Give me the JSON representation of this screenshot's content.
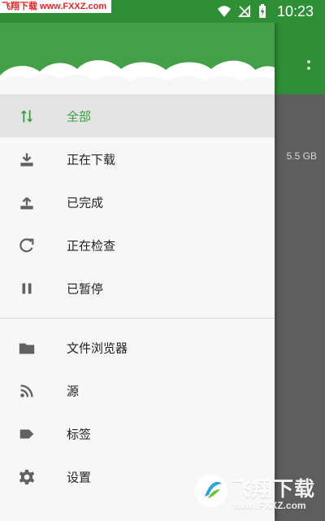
{
  "status_bar": {
    "watermark": "飞翔下载 www.FXXZ.com",
    "time": "10:23"
  },
  "background": {
    "storage_text": "5.5 GB"
  },
  "drawer": {
    "items": [
      {
        "label": "全部",
        "icon": "swap-vert-icon",
        "active": true
      },
      {
        "label": "正在下载",
        "icon": "download-icon",
        "active": false
      },
      {
        "label": "已完成",
        "icon": "upload-icon",
        "active": false
      },
      {
        "label": "正在检查",
        "icon": "refresh-icon",
        "active": false
      },
      {
        "label": "已暂停",
        "icon": "pause-icon",
        "active": false
      },
      {
        "label": "文件浏览器",
        "icon": "folder-icon",
        "active": false
      },
      {
        "label": "源",
        "icon": "rss-icon",
        "active": false
      },
      {
        "label": "标签",
        "icon": "tag-icon",
        "active": false
      },
      {
        "label": "设置",
        "icon": "gear-icon",
        "active": false
      }
    ]
  },
  "watermark_bottom": {
    "title": "飞翔下载",
    "url": "www.FXXZ.com"
  },
  "colors": {
    "accent": "#35a13e",
    "header_green": "#43a047",
    "status_green": "#2f8f36"
  }
}
